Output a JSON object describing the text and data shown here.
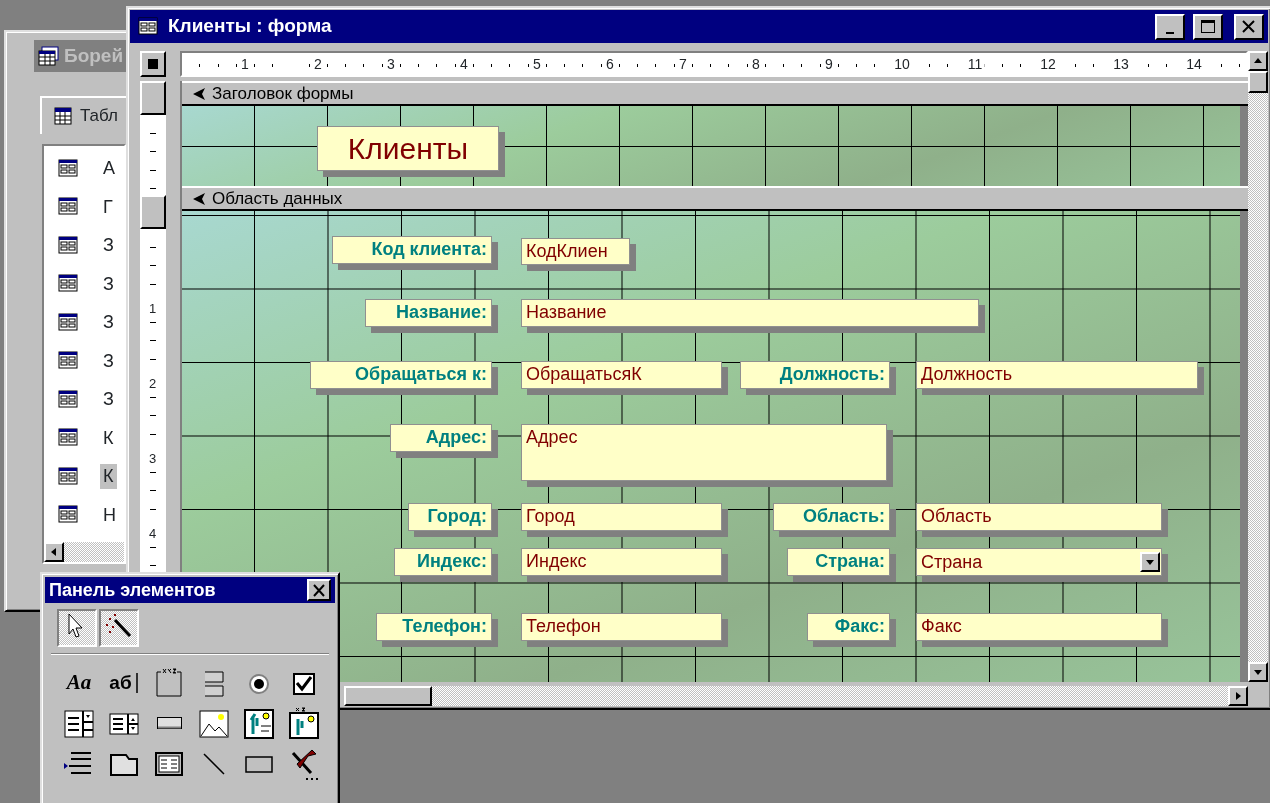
{
  "database_window": {
    "title": "Борей",
    "tab": "Табл",
    "items": [
      {
        "text": "А",
        "selected": false
      },
      {
        "text": "Г",
        "selected": false
      },
      {
        "text": "З",
        "selected": false
      },
      {
        "text": "З",
        "selected": false
      },
      {
        "text": "З",
        "selected": false
      },
      {
        "text": "З",
        "selected": false
      },
      {
        "text": "З",
        "selected": false
      },
      {
        "text": "К",
        "selected": false
      },
      {
        "text": "К",
        "selected": true
      },
      {
        "text": "Н",
        "selected": false
      }
    ]
  },
  "form_window": {
    "title": "Клиенты : форма",
    "ruler": [
      "1",
      "2",
      "3",
      "4",
      "5",
      "6",
      "7",
      "8",
      "9",
      "10",
      "11",
      "12",
      "13",
      "14"
    ],
    "vertical_ruler": [
      "1",
      "2",
      "3",
      "4"
    ],
    "sections": [
      {
        "title": "Заголовок формы",
        "controls": [
          {
            "kind": "title",
            "text": "Клиенты"
          }
        ]
      },
      {
        "title": "Область данных",
        "controls": [
          {
            "kind": "label",
            "text": "Код клиента:"
          },
          {
            "kind": "textbox",
            "text": "КодКлиен"
          },
          {
            "kind": "label",
            "text": "Название:"
          },
          {
            "kind": "textbox",
            "text": "Название"
          },
          {
            "kind": "label",
            "text": "Обращаться к:"
          },
          {
            "kind": "textbox",
            "text": "ОбращатьсяК"
          },
          {
            "kind": "label",
            "text": "Должность:"
          },
          {
            "kind": "textbox",
            "text": "Должность"
          },
          {
            "kind": "label",
            "text": "Адрес:"
          },
          {
            "kind": "textbox",
            "text": "Адрес"
          },
          {
            "kind": "label",
            "text": "Город:"
          },
          {
            "kind": "textbox",
            "text": "Город"
          },
          {
            "kind": "label",
            "text": "Область:"
          },
          {
            "kind": "textbox",
            "text": "Область"
          },
          {
            "kind": "label",
            "text": "Индекс:"
          },
          {
            "kind": "textbox",
            "text": "Индекс"
          },
          {
            "kind": "label",
            "text": "Страна:"
          },
          {
            "kind": "combobox",
            "text": "Страна"
          },
          {
            "kind": "label",
            "text": "Телефон:"
          },
          {
            "kind": "textbox",
            "text": "Телефон"
          },
          {
            "kind": "label",
            "text": "Факс:"
          },
          {
            "kind": "textbox",
            "text": "Факс"
          }
        ]
      }
    ]
  },
  "toolbox": {
    "title": "Панель элементов",
    "tools": [
      {
        "kind": "pointer",
        "pressed": true
      },
      {
        "kind": "wizard",
        "pressed": true
      },
      {
        "kind": "label",
        "glyph": "Aa",
        "pressed": false
      },
      {
        "kind": "textbox",
        "glyph": "аб",
        "pressed": false
      },
      {
        "kind": "frame",
        "pressed": false
      },
      {
        "kind": "toggle",
        "pressed": false
      },
      {
        "kind": "radio",
        "pressed": false
      },
      {
        "kind": "checkbox",
        "pressed": false
      },
      {
        "kind": "combo",
        "pressed": false
      },
      {
        "kind": "list",
        "pressed": false
      },
      {
        "kind": "button",
        "pressed": false
      },
      {
        "kind": "picture",
        "pressed": false
      },
      {
        "kind": "object",
        "pressed": false
      },
      {
        "kind": "object-frame",
        "pressed": false
      },
      {
        "kind": "page-break",
        "pressed": false
      },
      {
        "kind": "tab",
        "pressed": false
      },
      {
        "kind": "form",
        "pressed": false
      },
      {
        "kind": "line",
        "pressed": false
      },
      {
        "kind": "rectangle",
        "pressed": false
      },
      {
        "kind": "tools",
        "pressed": false
      }
    ]
  }
}
